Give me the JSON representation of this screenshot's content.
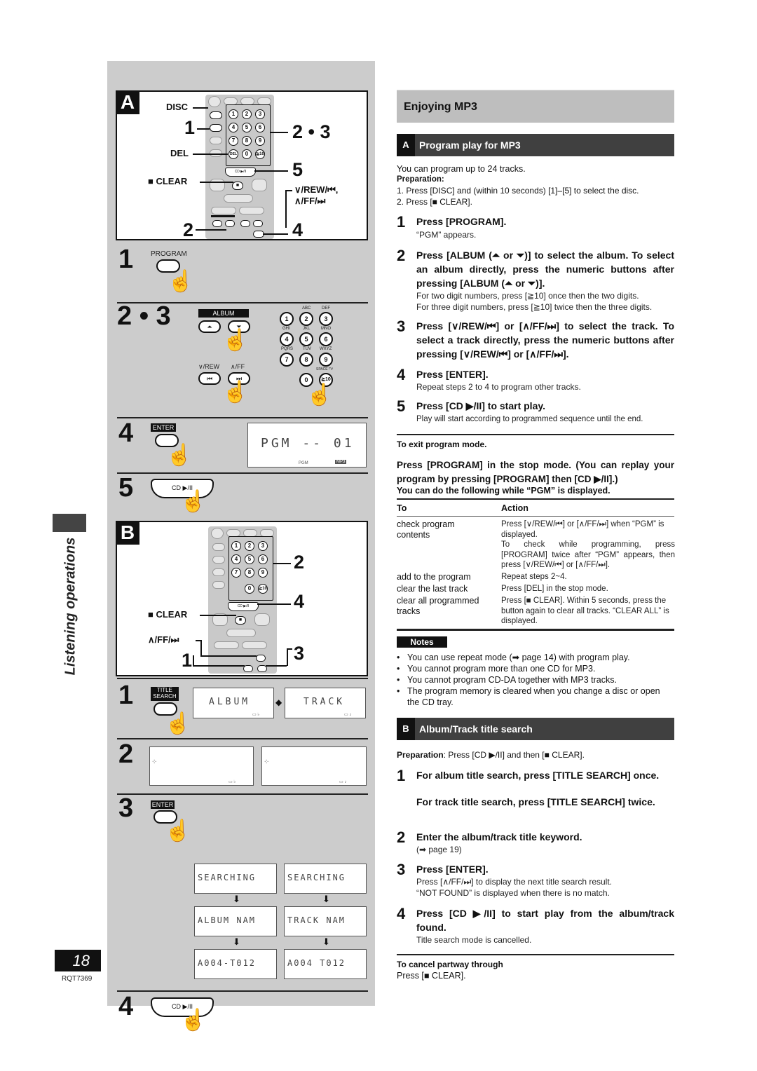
{
  "left": {
    "sectionA": {
      "letter": "A",
      "remote_callouts": {
        "disc": "DISC",
        "step1": "1",
        "del": "DEL",
        "clear": "■ CLEAR",
        "step2": "2",
        "step23": "2 • 3",
        "step5": "5",
        "rewff_line1": "∨/REW/⏮,",
        "rewff_line2": "∧/FF/⏭",
        "step4": "4"
      }
    },
    "sectionA_steps": [
      {
        "number": "1",
        "button_label": "PROGRAM"
      },
      {
        "number": "2 • 3",
        "album_label": "ALBUM",
        "album_buttons": [
          "⏶",
          "⏷"
        ],
        "rew_label": "∨/REW",
        "ff_label": "∧/FF",
        "rew_button": "⏮",
        "ff_button": "⏭",
        "keypad": {
          "letters_row1": [
            "ABC",
            "DEF"
          ],
          "row1": [
            "1",
            "2",
            "3"
          ],
          "letters_row2": [
            "GHI",
            "JKL",
            "MNO"
          ],
          "row2": [
            "4",
            "5",
            "6"
          ],
          "letters_row3": [
            "PQRS",
            "TUV",
            "WXYZ"
          ],
          "row3": [
            "7",
            "8",
            "9"
          ],
          "space_label": "SPACE !\"#",
          "row4": [
            "0",
            "≧10"
          ]
        }
      },
      {
        "number": "4",
        "button_label": "ENTER",
        "lcd_text": "PGM  --  01",
        "lcd_pgm_indicator": "PGM",
        "lcd_mp3_indicator": "MP3"
      },
      {
        "number": "5",
        "button_label": "CD ▶/II"
      }
    ],
    "sectionB": {
      "letter": "B",
      "remote_callouts": {
        "step2": "2",
        "step4": "4",
        "clear": "■ CLEAR",
        "ff": "∧/FF/⏭",
        "step1": "1",
        "step3": "3"
      }
    },
    "sectionB_steps": [
      {
        "number": "1",
        "button_label_line1": "TITLE",
        "button_label_line2": "SEARCH",
        "lcd_album": "ALBUM",
        "lcd_track": "TRACK",
        "toggle_arrow": "◆"
      },
      {
        "number": "2"
      },
      {
        "number": "3",
        "button_label": "ENTER",
        "album_flow": [
          "SEARCHING",
          "ALBUM NAM",
          "A004-T012"
        ],
        "track_flow": [
          "SEARCHING",
          "TRACK NAM",
          "A004 T012"
        ]
      },
      {
        "number": "4",
        "button_label": "CD ▶/II"
      }
    ],
    "side_title": "Listening operations",
    "page_number": "18",
    "doc_code": "RQT7369"
  },
  "right": {
    "title": "Enjoying MP3",
    "sectionA": {
      "letter": "A",
      "heading": "Program play for MP3",
      "intro": "You can program up to 24 tracks.",
      "preparation_label": "Preparation:",
      "preparation_steps": [
        "1. Press [DISC] and (within 10 seconds) [1]–[5] to select the disc.",
        "2. Press [■ CLEAR]."
      ],
      "steps": [
        {
          "n": "1",
          "heading": "Press [PROGRAM].",
          "sub": [
            "“PGM” appears."
          ]
        },
        {
          "n": "2",
          "heading": "Press [ALBUM (⏶ or ⏷)] to select the album. To select an album directly, press the numeric buttons after pressing [ALBUM (⏶ or ⏷)].",
          "sub": [
            "For two digit numbers, press [≧10] once then the two digits.",
            "For three digit numbers, press [≧10] twice then the three digits."
          ]
        },
        {
          "n": "3",
          "heading": "Press [∨/REW/⏮] or [∧/FF/⏭] to select the track. To select a track directly, press the numeric buttons after pressing [∨/REW/⏮] or [∧/FF/⏭].",
          "sub": []
        },
        {
          "n": "4",
          "heading": "Press [ENTER].",
          "sub": [
            "Repeat steps 2 to 4 to program other tracks."
          ]
        },
        {
          "n": "5",
          "heading": "Press [CD ▶/II] to start play.",
          "sub": [
            "Play will start according to programmed sequence until the end."
          ]
        }
      ],
      "exit_label": "To exit program mode.",
      "exit_text": "Press [PROGRAM] in the stop mode. (You can replay your program by pressing [PROGRAM] then [CD ▶/II].)",
      "table_caption": "You can do the following while “PGM” is displayed.",
      "table": {
        "headers": [
          "To",
          "Action"
        ],
        "rows": [
          {
            "to": "check program contents",
            "action": "Press [∨/REW/⏮] or [∧/FF/⏭] when “PGM” is displayed.",
            "action2": "To check while programming, press [PROGRAM] twice after “PGM” appears, then press [∨/REW/⏮] or [∧/FF/⏭]."
          },
          {
            "to": "add to the program",
            "action": "Repeat steps 2~4."
          },
          {
            "to": "clear the last track",
            "action": "Press [DEL] in the stop mode."
          },
          {
            "to": "clear all programmed tracks",
            "action": "Press [■ CLEAR]. Within 5 seconds, press the button again to clear all tracks. “CLEAR ALL” is displayed."
          }
        ]
      },
      "notes_label": "Notes",
      "notes": [
        "You can use repeat mode (➡ page 14) with program play.",
        "You cannot program more than one CD for MP3.",
        "You cannot program CD-DA together with MP3 tracks.",
        "The program memory is cleared when you change a disc or open the CD tray."
      ]
    },
    "sectionB": {
      "letter": "B",
      "heading": "Album/Track title search",
      "preparation_label": "Preparation",
      "preparation_text": ": Press [CD ▶/II] and then [■ CLEAR].",
      "steps": [
        {
          "n": "1",
          "heading": "For album title search, press [TITLE SEARCH] once.",
          "heading2": "For track title search, press [TITLE SEARCH] twice."
        },
        {
          "n": "2",
          "heading": "Enter the album/track title keyword.",
          "sub": [
            "(➡ page 19)"
          ]
        },
        {
          "n": "3",
          "heading": "Press [ENTER].",
          "sub": [
            "Press [∧/FF/⏭] to display the next title search result.",
            "“NOT FOUND” is displayed when there is no match."
          ]
        },
        {
          "n": "4",
          "heading": "Press [CD ▶/II] to start play from the album/track found.",
          "sub": [
            "Title search mode is cancelled."
          ]
        }
      ],
      "cancel_label": "To cancel partway through",
      "cancel_text": "Press [■ CLEAR]."
    }
  }
}
